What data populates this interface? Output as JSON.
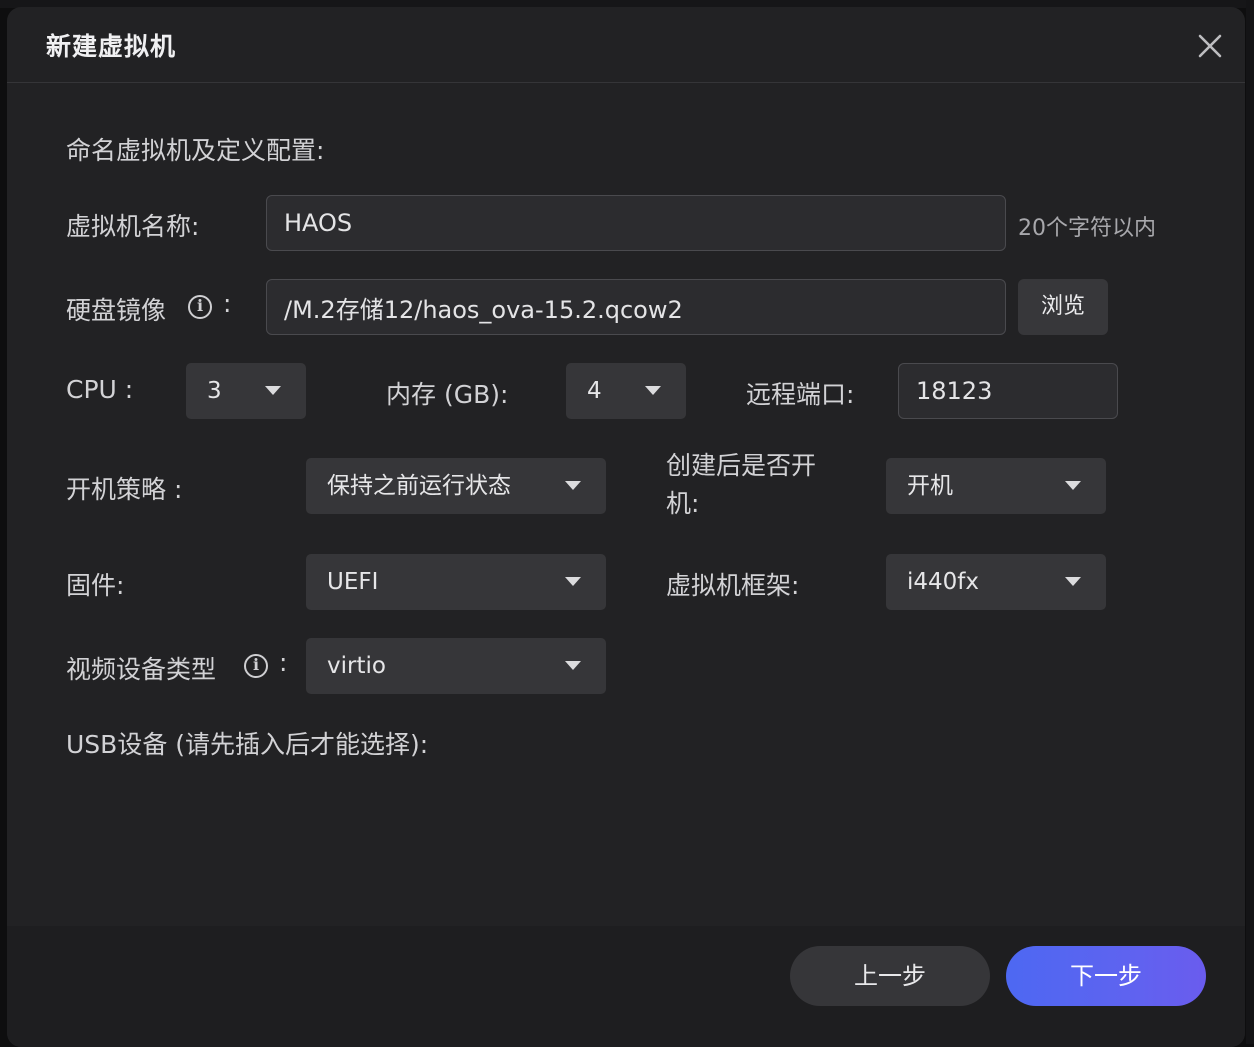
{
  "dialog": {
    "title": "新建虚拟机",
    "close_icon": "close-icon"
  },
  "form": {
    "section_title": "命名虚拟机及定义配置:",
    "vm_name": {
      "label": "虚拟机名称:",
      "value": "HAOS",
      "hint": "20个字符以内"
    },
    "disk_image": {
      "label": "硬盘镜像",
      "colon": ":",
      "info_icon": "info-circle-icon",
      "value": "/M.2存储12/haos_ova-15.2.qcow2",
      "browse_label": "浏览"
    },
    "cpu": {
      "label": "CPU :",
      "value": "3"
    },
    "memory": {
      "label": "内存 (GB):",
      "value": "4"
    },
    "remote_port": {
      "label": "远程端口:",
      "value": "18123"
    },
    "boot_policy": {
      "label": "开机策略 :",
      "value": "保持之前运行状态"
    },
    "power_on_after_create": {
      "label": "创建后是否开机:",
      "value": "开机"
    },
    "firmware": {
      "label": "固件:",
      "value": "UEFI"
    },
    "vm_machine": {
      "label": "虚拟机框架:",
      "value": "i440fx"
    },
    "video_device": {
      "label": "视频设备类型",
      "colon": ":",
      "info_icon": "info-circle-icon",
      "value": "virtio"
    },
    "usb": {
      "label": "USB设备 (请先插入后才能选择):"
    }
  },
  "footer": {
    "prev_label": "上一步",
    "next_label": "下一步"
  },
  "colors": {
    "dialog_bg": "#222224",
    "select_bg": "#363639",
    "accent_start": "#4d68f2",
    "accent_end": "#6a5cee"
  }
}
